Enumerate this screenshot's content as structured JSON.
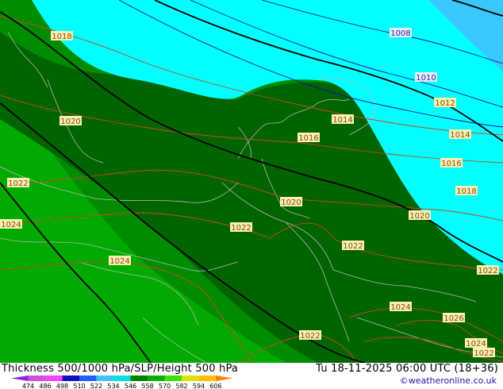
{
  "header": {
    "title_left": "Thickness 500/1000 hPa/SLP/Height 500 hPa",
    "title_right": "Tu 18-11-2025 06:00 UTC (18+36)",
    "credit": "©weatheronline.co.uk"
  },
  "legend": {
    "ticks": [
      "474",
      "486",
      "498",
      "510",
      "522",
      "534",
      "546",
      "558",
      "570",
      "582",
      "594",
      "606"
    ],
    "colors": [
      "#8a2be2",
      "#d050e0",
      "#ff40ff",
      "#1010c0",
      "#2060ff",
      "#40c0ff",
      "#00e0e0",
      "#008000",
      "#00b000",
      "#40e000",
      "#e0e000",
      "#ffc000",
      "#ff8000"
    ]
  },
  "colors": {
    "cyan": "#00ffff",
    "light_blue": "#38c8ff",
    "dark_green": "#006400",
    "mid_green": "#008c00",
    "green": "#00aa00",
    "isobar": "#c84828",
    "thickness_line": "#1010a0",
    "height500": "#000000"
  },
  "isobar_labels": [
    {
      "text": "1018"
    },
    {
      "text": "1020"
    },
    {
      "text": "1022"
    },
    {
      "text": "1024"
    },
    {
      "text": "1024"
    },
    {
      "text": "1014"
    },
    {
      "text": "1016"
    },
    {
      "text": "1020"
    },
    {
      "text": "1022"
    },
    {
      "text": "1022"
    },
    {
      "text": "1014"
    },
    {
      "text": "1016"
    },
    {
      "text": "1018"
    },
    {
      "text": "1020"
    },
    {
      "text": "1022"
    },
    {
      "text": "1024"
    },
    {
      "text": "1026"
    },
    {
      "text": "1024"
    },
    {
      "text": "1022"
    },
    {
      "text": "1022"
    },
    {
      "text": "1012"
    }
  ],
  "blue_labels": [
    {
      "text": "1008"
    },
    {
      "text": "1010"
    }
  ]
}
